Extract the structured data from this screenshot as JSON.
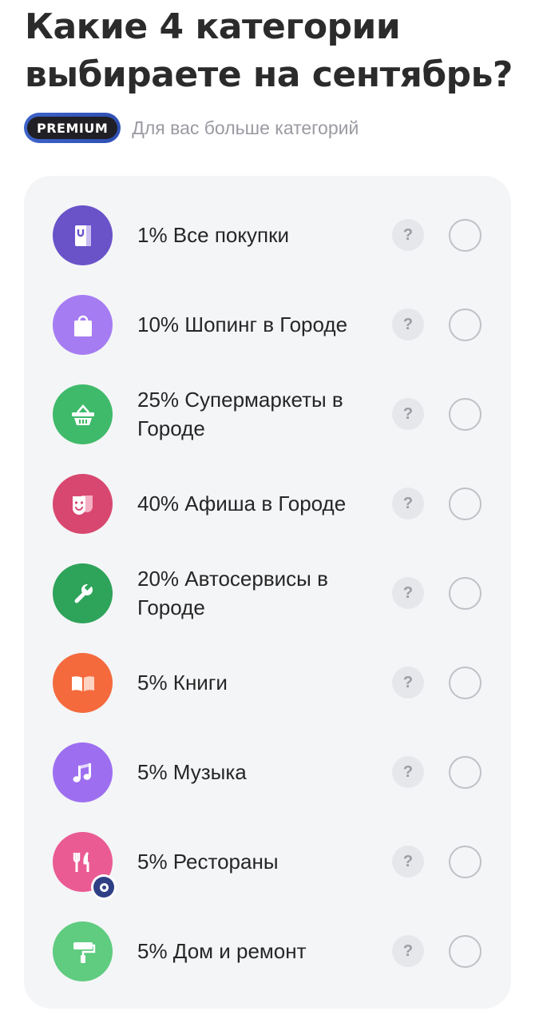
{
  "header": {
    "title": "Какие 4 категории выбираете на сентябрь?",
    "premium_badge": "PREMIUM",
    "premium_note": "Для вас больше категорий"
  },
  "categories": [
    {
      "label": "1% Все покупки",
      "icon": "shopping-bag-icon",
      "color": "#6a52c9"
    },
    {
      "label": "10% Шопинг в Городе",
      "icon": "paper-bag-icon",
      "color": "#a57cf2"
    },
    {
      "label": "25% Супермаркеты в Городе",
      "icon": "basket-icon",
      "color": "#3fba6a"
    },
    {
      "label": "40% Афиша в Городе",
      "icon": "theater-masks-icon",
      "color": "#d8476f"
    },
    {
      "label": "20% Автосервисы в Городе",
      "icon": "wrench-icon",
      "color": "#2ea35a"
    },
    {
      "label": "5% Книги",
      "icon": "open-book-icon",
      "color": "#f46a3d"
    },
    {
      "label": "5% Музыка",
      "icon": "music-note-icon",
      "color": "#9d6ff0"
    },
    {
      "label": "5% Рестораны",
      "icon": "cutlery-icon",
      "color": "#ea5b93"
    },
    {
      "label": "5% Дом и ремонт",
      "icon": "paint-roller-icon",
      "color": "#5fcc7f"
    }
  ],
  "help_symbol": "?"
}
